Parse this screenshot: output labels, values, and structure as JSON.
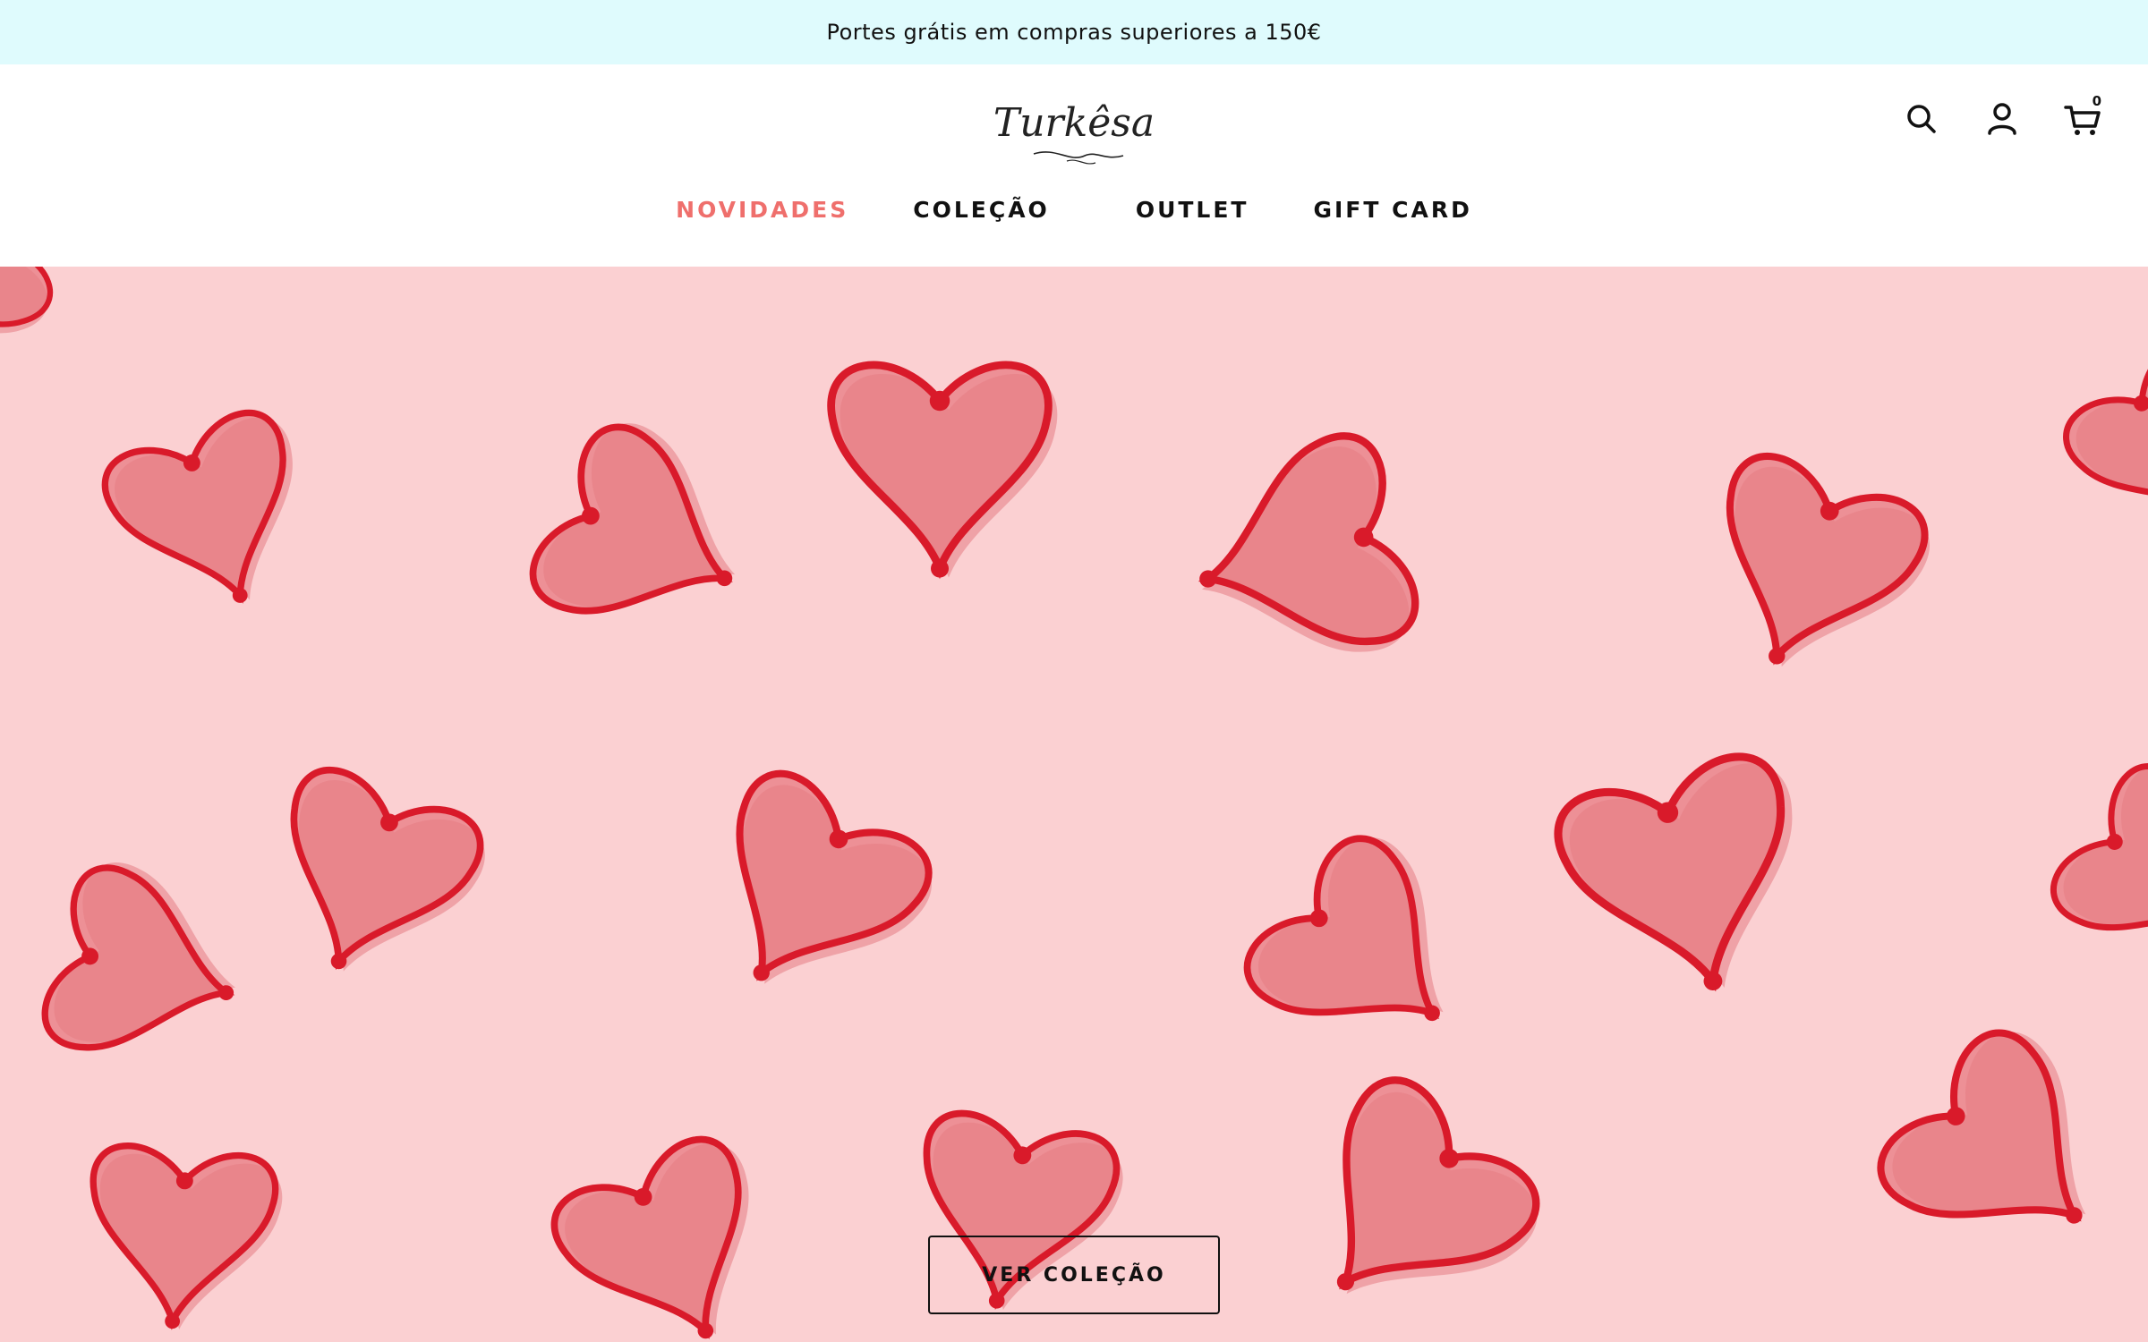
{
  "announcement": {
    "text": "Portes grátis em compras superiores a 150€"
  },
  "header": {
    "logo_text": "Turkêsa",
    "cart_count": "0",
    "icons": [
      "search-icon",
      "account-icon",
      "cart-icon"
    ]
  },
  "nav": {
    "items": [
      {
        "label": "NOVIDADES",
        "active": true
      },
      {
        "label": "COLEÇÃO",
        "active": false
      },
      {
        "label": "OUTLET",
        "active": false
      },
      {
        "label": "GIFT CARD",
        "active": false
      }
    ]
  },
  "hero": {
    "cta_label": "VER COLEÇÃO"
  },
  "colors": {
    "announcement_bg": "#dffbfd",
    "accent": "#ef6f6c",
    "hero_bg": "#fbd0d2",
    "heart_fill": "#ec8a90",
    "heart_stroke": "#d91a2a"
  }
}
